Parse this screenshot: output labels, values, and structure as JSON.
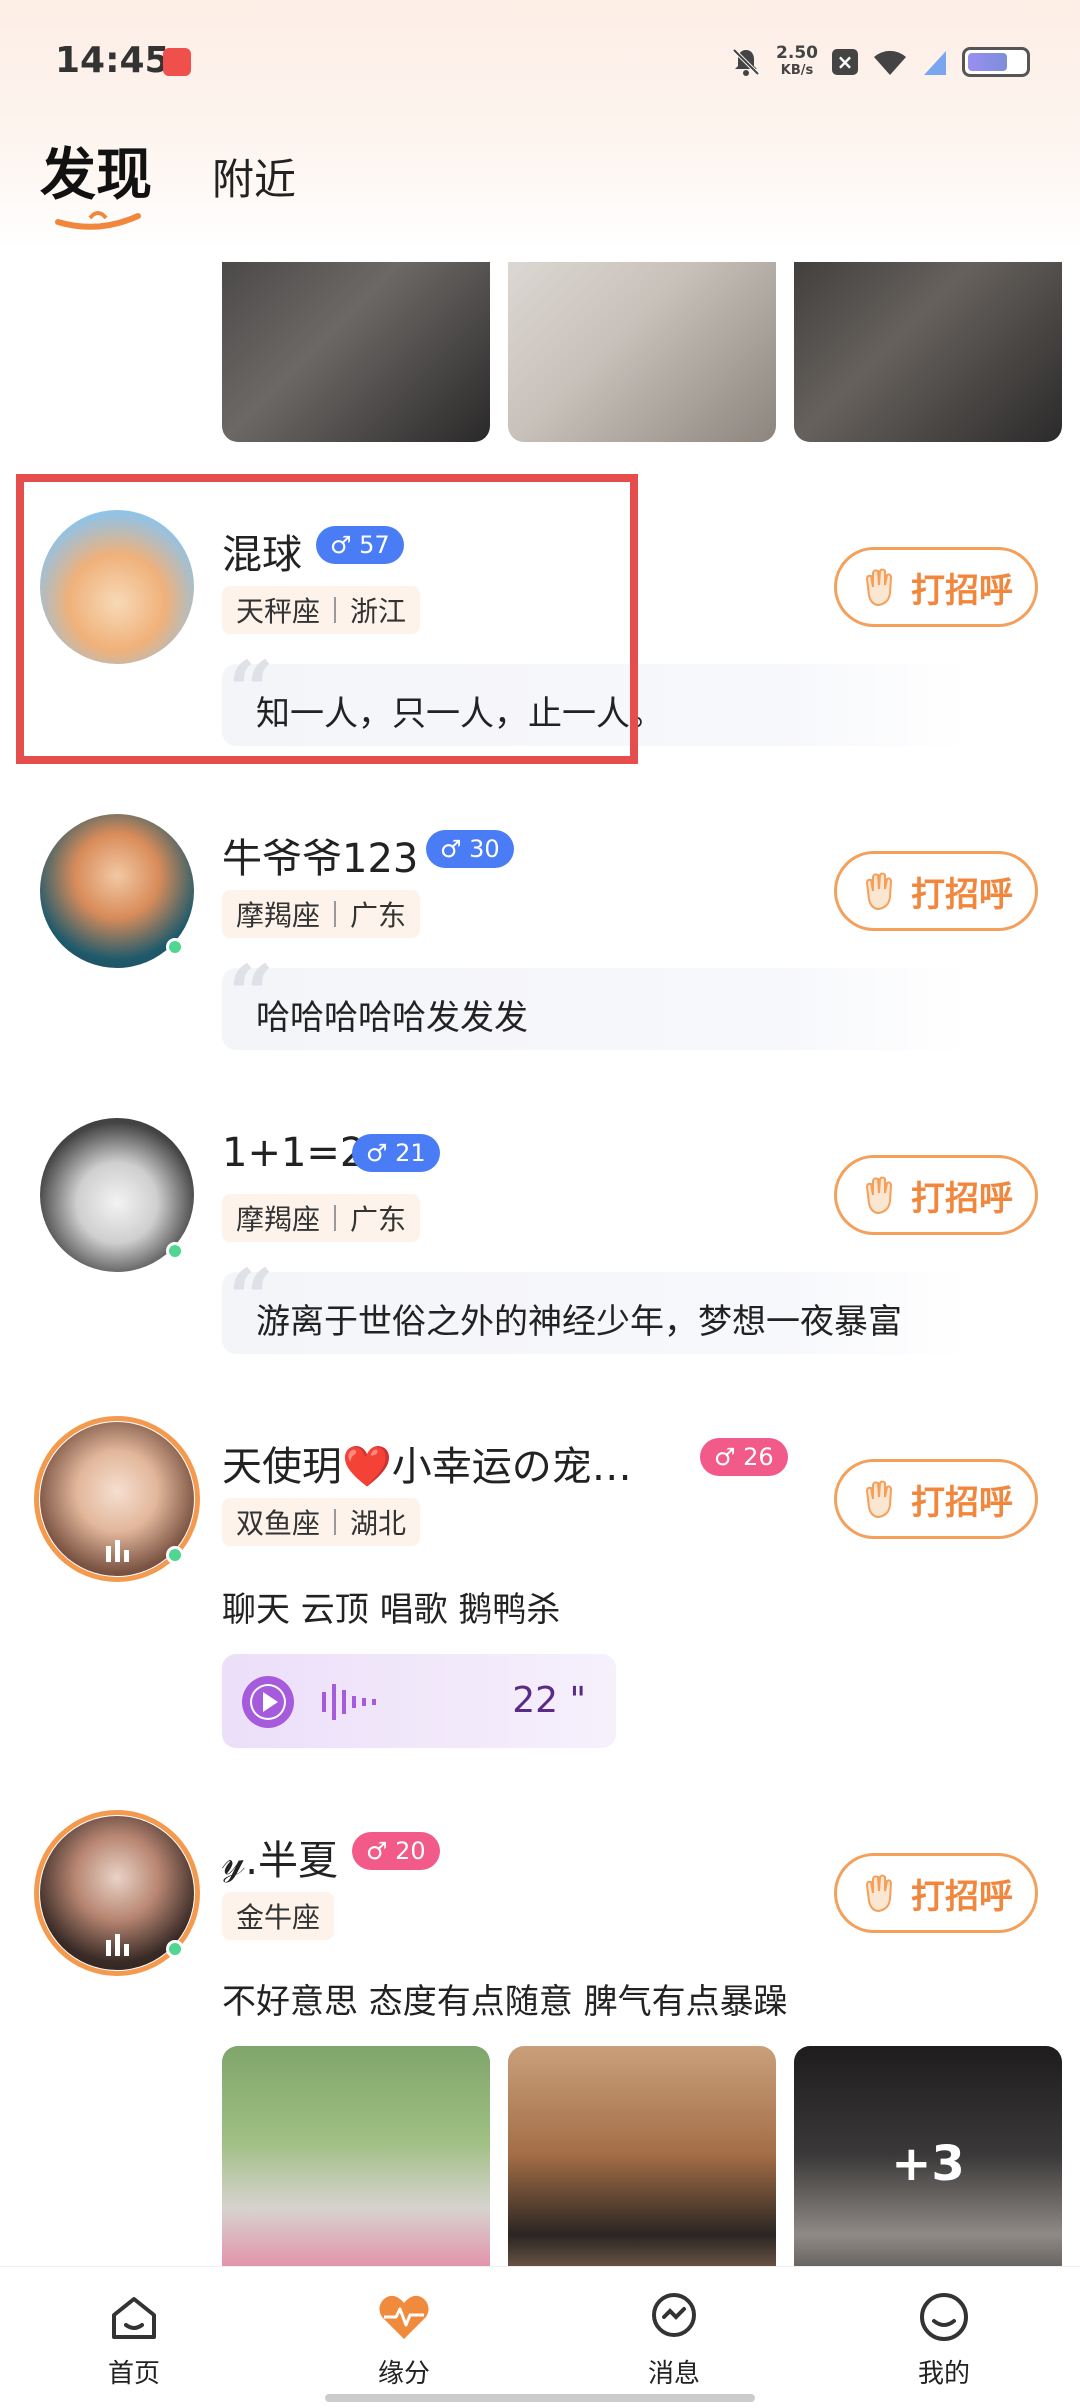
{
  "status_bar": {
    "time": "14:45",
    "net_speed_value": "2.50",
    "net_speed_unit": "KB/s",
    "battery_level": 0.7
  },
  "tabs": [
    {
      "label": "发现",
      "active": true
    },
    {
      "label": "附近",
      "active": false
    }
  ],
  "greet_label": "打招呼",
  "users": [
    {
      "name": "混球",
      "gender_symbol": "♂",
      "age": "57",
      "constellation": "天秤座",
      "region": "浙江",
      "signature": "知一人，只一人，止一人。",
      "badge_color": "#4a7df5",
      "online": false
    },
    {
      "name": "牛爷爷123",
      "gender_symbol": "♂",
      "age": "30",
      "constellation": "摩羯座",
      "region": "广东",
      "signature": "哈哈哈哈哈发发发",
      "badge_color": "#4a7df5",
      "online": true
    },
    {
      "name": "1+1=2",
      "gender_symbol": "♂",
      "age": "21",
      "constellation": "摩羯座",
      "region": "广东",
      "signature": "游离于世俗之外的神经少年，梦想一夜暴富",
      "badge_color": "#4a7df5",
      "online": true
    },
    {
      "name": "天使玥❤️小幸运の宠…",
      "gender_symbol": "♂",
      "age": "26",
      "constellation": "双鱼座",
      "region": "湖北",
      "interests": "聊天 云顶 唱歌 鹅鸭杀",
      "voice_duration": "22 \"",
      "badge_color": "#f25a8a",
      "online": true
    },
    {
      "name": "𝓎.半夏",
      "gender_symbol": "♂",
      "age": "20",
      "constellation": "金牛座",
      "bio": "不好意思 态度有点随意 脾气有点暴躁",
      "more_photos": "+3",
      "badge_color": "#f25a8a",
      "online": true
    }
  ],
  "bottom_nav": [
    {
      "label": "首页",
      "icon": "home-icon"
    },
    {
      "label": "缘分",
      "icon": "heart-pulse-icon",
      "active": true
    },
    {
      "label": "消息",
      "icon": "message-icon"
    },
    {
      "label": "我的",
      "icon": "profile-icon"
    }
  ],
  "colors": {
    "accent": "#f0873d",
    "highlight": "#e64d4d",
    "male_badge": "#4a7df5",
    "female_badge": "#f25a8a"
  }
}
